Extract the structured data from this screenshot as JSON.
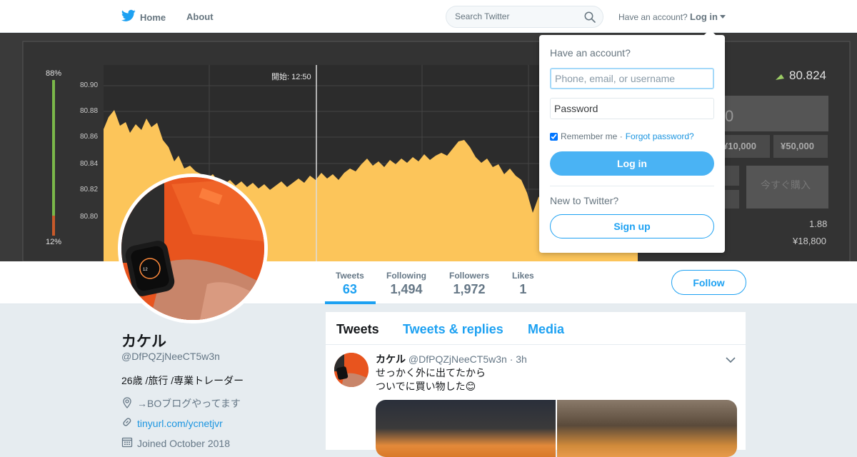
{
  "topnav": {
    "home_label": "Home",
    "about_label": "About",
    "search_placeholder": "Search Twitter",
    "have_account": "Have an account?",
    "login_label": "Log in"
  },
  "header_image": {
    "percent_top": "88%",
    "percent_bottom": "12%",
    "y_ticks": [
      "80.90",
      "80.88",
      "80.86",
      "80.84",
      "80.82",
      "80.80"
    ],
    "start_label": "開始: 12:50",
    "price": "80.824",
    "amount_partial": "0",
    "btn_10000": "¥10,000",
    "btn_50000": "¥50,000",
    "buy_now": "今すぐ購入",
    "payout_rate": "1.88",
    "payout_amount": "¥18,800",
    "colors": {
      "area": "#fcc55a",
      "panel": "#333333"
    }
  },
  "profile_nav": {
    "stats": [
      {
        "label": "Tweets",
        "value": "63"
      },
      {
        "label": "Following",
        "value": "1,494"
      },
      {
        "label": "Followers",
        "value": "1,972"
      },
      {
        "label": "Likes",
        "value": "1"
      }
    ],
    "follow_label": "Follow"
  },
  "profile": {
    "name": "カケル",
    "handle": "@DfPQZjNeeCT5w3n",
    "bio": "26歳 /旅行 /専業トレーダー",
    "location": "→BOブログやってます",
    "url": "tinyurl.com/ycnetjvr",
    "joined": "Joined October 2018"
  },
  "timeline": {
    "tabs": [
      "Tweets",
      "Tweets & replies",
      "Media"
    ],
    "tweet": {
      "name": "カケル",
      "handle": "@DfPQZjNeeCT5w3n",
      "time": "· 3h",
      "line1": "せっかく外に出てたから",
      "line2": "ついでに買い物した😊"
    }
  },
  "login_dropdown": {
    "title": "Have an account?",
    "username_placeholder": "Phone, email, or username",
    "password_placeholder": "Password",
    "remember": "Remember me ·",
    "forgot": "Forgot password?",
    "login_button": "Log in",
    "new_to_twitter": "New to Twitter?",
    "signup_button": "Sign up"
  },
  "accent_color": "#1da1f2"
}
